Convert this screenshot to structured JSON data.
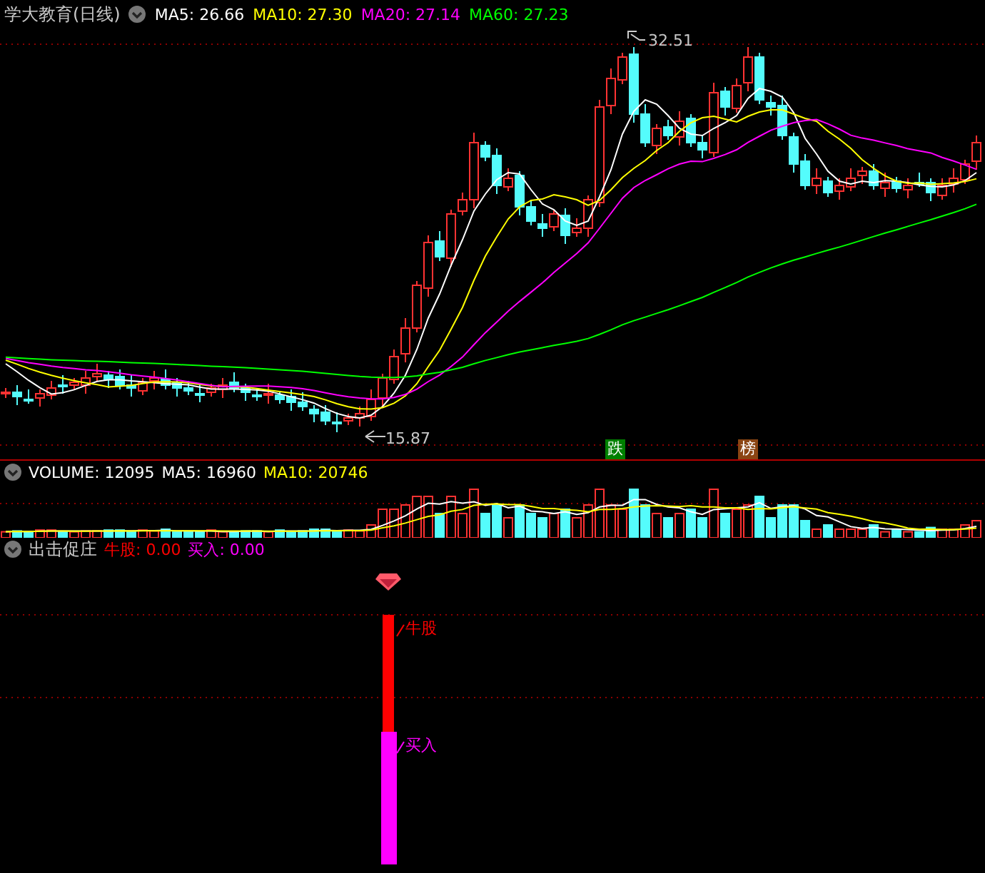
{
  "title": "学大教育(日线)",
  "ma_legend": [
    {
      "label": "MA5: 26.66",
      "color": "#ffffff"
    },
    {
      "label": "MA10: 27.30",
      "color": "#ffff00"
    },
    {
      "label": "MA20: 27.14",
      "color": "#ff00ff"
    },
    {
      "label": "MA60: 27.23",
      "color": "#00ff00"
    }
  ],
  "price_chart": {
    "high_label": "32.51",
    "low_label": "15.87",
    "signals": [
      {
        "text": "跌",
        "color": "#008000"
      },
      {
        "text": "榜",
        "color": "#8b4513"
      }
    ]
  },
  "volume_legend": [
    {
      "label": "VOLUME: 12095",
      "color": "#ffffff"
    },
    {
      "label": "MA5: 16960",
      "color": "#ffffff"
    },
    {
      "label": "MA10: 20746",
      "color": "#ffff00"
    }
  ],
  "indicator": {
    "title": "出击促庄",
    "legend": [
      {
        "label": "牛股: 0.00",
        "color": "#ff0000"
      },
      {
        "label": "买入: 0.00",
        "color": "#ff00ff"
      }
    ],
    "bar_labels": [
      {
        "text": "牛股",
        "color": "#ff0000"
      },
      {
        "text": "买入",
        "color": "#ff00ff"
      }
    ]
  }
}
